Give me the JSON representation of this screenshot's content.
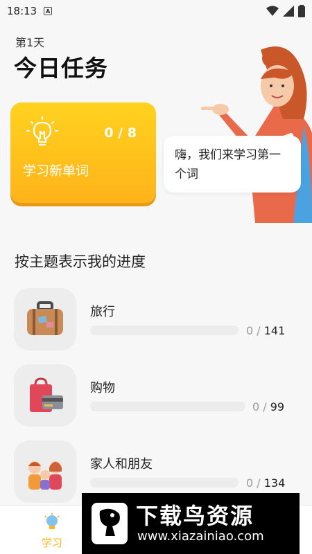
{
  "status_bar": {
    "time": "18:13",
    "notif_letter": "A"
  },
  "header": {
    "day": "第1天",
    "title": "今日任务"
  },
  "task_card": {
    "count": "0 / 8",
    "label": "学习新单词"
  },
  "bubble": {
    "text": "嗨，我们来学习第一个词"
  },
  "section": {
    "title": "按主题表示我的进度"
  },
  "topics": [
    {
      "name": "旅行",
      "learned": "0",
      "total": "141",
      "progress": 0,
      "icon": "suitcase-icon"
    },
    {
      "name": "购物",
      "learned": "0",
      "total": "99",
      "progress": 0,
      "icon": "shopping-bag-icon"
    },
    {
      "name": "家人和朋友",
      "learned": "0",
      "total": "134",
      "progress": 0,
      "icon": "family-icon"
    }
  ],
  "tab_bar": {
    "learn_label": "学习",
    "learn_icon": "lightbulb-icon"
  },
  "watermark": {
    "title": "下载鸟资源",
    "url": "www.xiazainiao.com"
  },
  "colors": {
    "accent": "#ffb31a",
    "card_top": "#ffd21f",
    "background": "#f7f7f7"
  }
}
